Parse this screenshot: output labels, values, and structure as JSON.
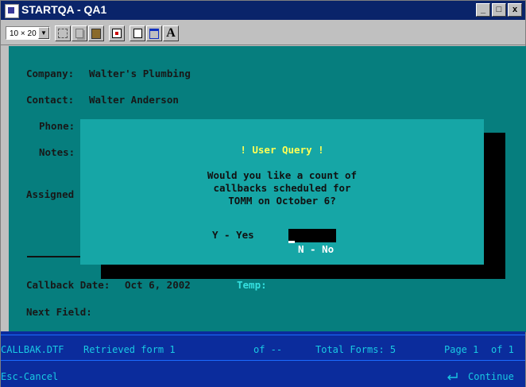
{
  "window": {
    "title": "STARTQA - QA1",
    "controls": [
      "_",
      "□",
      "x"
    ]
  },
  "toolbar": {
    "font_size": "10 × 20",
    "buttons": [
      "select-icon",
      "copy-icon",
      "paste-icon",
      "fullscreen-icon",
      "properties-icon",
      "background-icon",
      "font-icon"
    ],
    "font_button_label": "A"
  },
  "form": {
    "company_label": "Company:",
    "company_value": "Walter's Plumbing",
    "contact_label": "Contact:",
    "contact_value": "Walter Anderson",
    "phone_label": "Phone:",
    "notes_label": "Notes:",
    "assigned_label": "Assigned",
    "callback_date_label": "Callback Date:",
    "callback_date_value": "Oct 6, 2002",
    "temp_label": "Temp:",
    "next_field_label": "Next Field:"
  },
  "dialog": {
    "title": "! User Query !",
    "message_lines": [
      "Would you like a count of",
      "callbacks scheduled for",
      "TOMM on October 6?"
    ],
    "yes_option": "Y - Yes",
    "no_option": "N - No"
  },
  "status_bar": {
    "file": "CALLBAK.DTF",
    "retrieved": "Retrieved form 1",
    "of": "of --",
    "total_forms": "Total Forms: 5",
    "page": "Page 1",
    "page_of": "of 1",
    "cancel": "Esc-Cancel",
    "continue": "Continue"
  },
  "colors": {
    "terminal_bg": "#067e7e",
    "dialog_bg": "#16a6a6",
    "status_bg": "#0b2c9c",
    "status_text": "#19c9e3",
    "highlight_title": "#ffff55"
  }
}
